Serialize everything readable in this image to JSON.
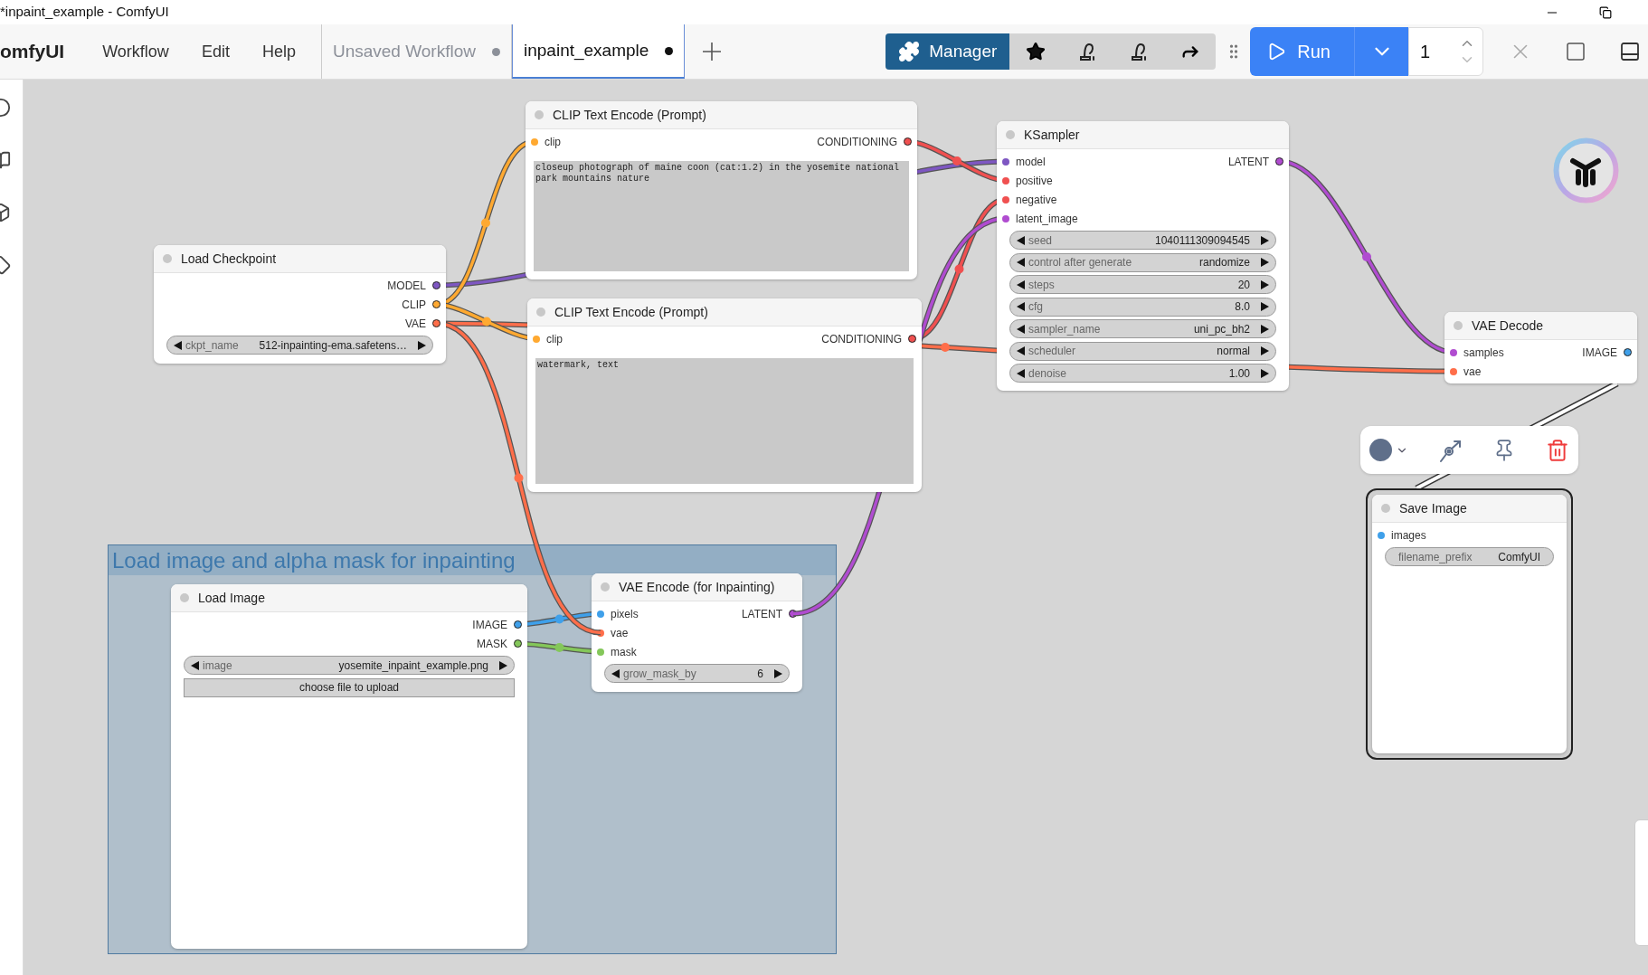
{
  "window": {
    "title": "*inpaint_example - ComfyUI"
  },
  "menu_bar": {
    "app_name": "omfyUI",
    "menus": [
      "Workflow",
      "Edit",
      "Help"
    ]
  },
  "tabs": [
    {
      "label": "Unsaved Workflow",
      "selected": false,
      "modified": true
    },
    {
      "label": "inpaint_example",
      "selected": true,
      "modified": true
    }
  ],
  "toolbar": {
    "manager_label": "Manager",
    "run_label": "Run",
    "batch_count": "1"
  },
  "group": {
    "title": "Load image and alpha mask for inpainting"
  },
  "nodes": [
    {
      "title": "Load Checkpoint",
      "selected": false,
      "outputs": [
        {
          "name": "MODEL",
          "color": "#7e57c2"
        },
        {
          "name": "CLIP",
          "color": "#ffa931"
        },
        {
          "name": "VAE",
          "color": "#ff6e4a"
        }
      ],
      "widgets": [
        {
          "kind": "combo",
          "label": "ckpt_name",
          "value": "512-inpainting-ema.safetens…"
        }
      ]
    },
    {
      "title": "CLIP Text Encode (Prompt)",
      "selected": false,
      "inputs": [
        {
          "name": "clip",
          "color": "#ffa931"
        }
      ],
      "outputs": [
        {
          "name": "CONDITIONING",
          "color": "#f05050"
        }
      ],
      "widgets": [
        {
          "kind": "text",
          "value": "closeup photograph of maine coon (cat:1.2) in the yosemite national park mountains nature"
        }
      ]
    },
    {
      "title": "CLIP Text Encode (Prompt)",
      "selected": false,
      "inputs": [
        {
          "name": "clip",
          "color": "#ffa931"
        }
      ],
      "outputs": [
        {
          "name": "CONDITIONING",
          "color": "#f05050"
        }
      ],
      "widgets": [
        {
          "kind": "text",
          "value": "watermark, text"
        }
      ]
    },
    {
      "title": "KSampler",
      "selected": false,
      "inputs": [
        {
          "name": "model",
          "color": "#7e57c2"
        },
        {
          "name": "positive",
          "color": "#f05050"
        },
        {
          "name": "negative",
          "color": "#f05050"
        },
        {
          "name": "latent_image",
          "color": "#b04cd0"
        }
      ],
      "outputs": [
        {
          "name": "LATENT",
          "color": "#b04cd0"
        }
      ],
      "widgets": [
        {
          "kind": "number",
          "label": "seed",
          "value": "1040111309094545"
        },
        {
          "kind": "combo",
          "label": "control after generate",
          "value": "randomize"
        },
        {
          "kind": "number",
          "label": "steps",
          "value": "20"
        },
        {
          "kind": "number",
          "label": "cfg",
          "value": "8.0"
        },
        {
          "kind": "combo",
          "label": "sampler_name",
          "value": "uni_pc_bh2"
        },
        {
          "kind": "combo",
          "label": "scheduler",
          "value": "normal"
        },
        {
          "kind": "number",
          "label": "denoise",
          "value": "1.00"
        }
      ]
    },
    {
      "title": "VAE Decode",
      "selected": false,
      "inputs": [
        {
          "name": "samples",
          "color": "#b04cd0"
        },
        {
          "name": "vae",
          "color": "#ff6e4a"
        }
      ],
      "outputs": [
        {
          "name": "IMAGE",
          "color": "#3fa0ea"
        }
      ]
    },
    {
      "title": "Save Image",
      "selected": true,
      "inputs": [
        {
          "name": "images",
          "color": "#3fa0ea"
        }
      ],
      "widgets": [
        {
          "kind": "string",
          "label": "filename_prefix",
          "value": "ComfyUI"
        }
      ]
    },
    {
      "title": "Load Image",
      "selected": false,
      "outputs": [
        {
          "name": "IMAGE",
          "color": "#3fa0ea"
        },
        {
          "name": "MASK",
          "color": "#84c75a"
        }
      ],
      "widgets": [
        {
          "kind": "combo",
          "label": "image",
          "value": "yosemite_inpaint_example.png"
        },
        {
          "kind": "button",
          "value": "choose file to upload"
        }
      ]
    },
    {
      "title": "VAE Encode (for Inpainting)",
      "selected": false,
      "inputs": [
        {
          "name": "pixels",
          "color": "#3fa0ea"
        },
        {
          "name": "vae",
          "color": "#ff6e4a"
        },
        {
          "name": "mask",
          "color": "#84c75a"
        }
      ],
      "outputs": [
        {
          "name": "LATENT",
          "color": "#b04cd0"
        }
      ],
      "widgets": [
        {
          "kind": "number",
          "label": "grow_mask_by",
          "value": "6"
        }
      ]
    }
  ]
}
